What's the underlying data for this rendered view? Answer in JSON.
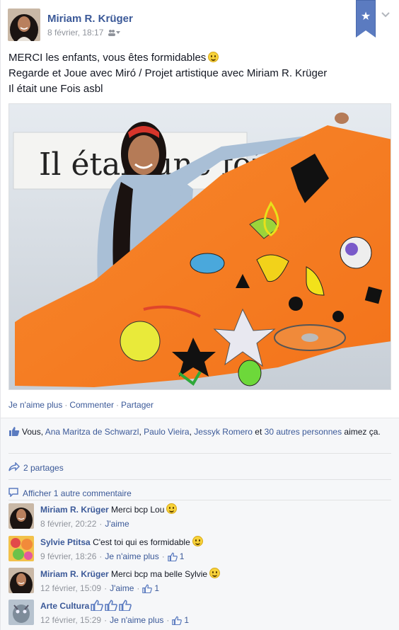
{
  "post": {
    "author": "Miriam R. Krüger",
    "date": "8 février, 18:17",
    "message_lines": [
      "MERCI les enfants, vous êtes formidables",
      "Regarde et Joue avec Miró / Projet artistique avec Miriam R. Krüger",
      "Il était une Fois asbl"
    ],
    "photo_banner_text": "Il était une fois"
  },
  "actions": {
    "unlike": "Je n'aime plus",
    "comment": "Commenter",
    "share": "Partager",
    "separator": "·"
  },
  "likes": {
    "prefix": "Vous, ",
    "names": [
      "Ana Maritza de Schwarzl",
      "Paulo Vieira",
      "Jessyk Romero"
    ],
    "sep": ", ",
    "and": " et ",
    "others": "30 autres personnes",
    "suffix": " aimez ça."
  },
  "shares": {
    "label": "2 partages"
  },
  "more_comments": {
    "label": "Afficher 1 autre commentaire"
  },
  "comments": [
    {
      "name": "Miriam R. Krüger",
      "text": "Merci bcp Lou",
      "smile": true,
      "date": "8 février, 20:22",
      "action": "J'aime",
      "likes": ""
    },
    {
      "name": "Sylvie Ptitsa",
      "text": "C'est toi qui es formidable",
      "smile": true,
      "date": "9 février, 18:26",
      "action": "Je n'aime plus",
      "likes": "1"
    },
    {
      "name": "Miriam R. Krüger",
      "text": "Merci bcp ma belle Sylvie",
      "smile": true,
      "date": "12 février, 15:09",
      "action": "J'aime",
      "likes": "1"
    },
    {
      "name": "Arte Cultura",
      "text": "",
      "smile": false,
      "date": "12 février, 15:29",
      "action": "Je n'aime plus",
      "likes": "1"
    }
  ],
  "colors": {
    "link": "#3b5998",
    "meta": "#90949c",
    "ufi_bg": "#f6f7f9",
    "ribbon": "#5b7bc0"
  },
  "icons": [
    "star-icon",
    "chevron-down-icon",
    "audience-icon",
    "like-thumb-icon",
    "share-arrow-icon",
    "comment-bubble-icon",
    "smiley-icon"
  ]
}
